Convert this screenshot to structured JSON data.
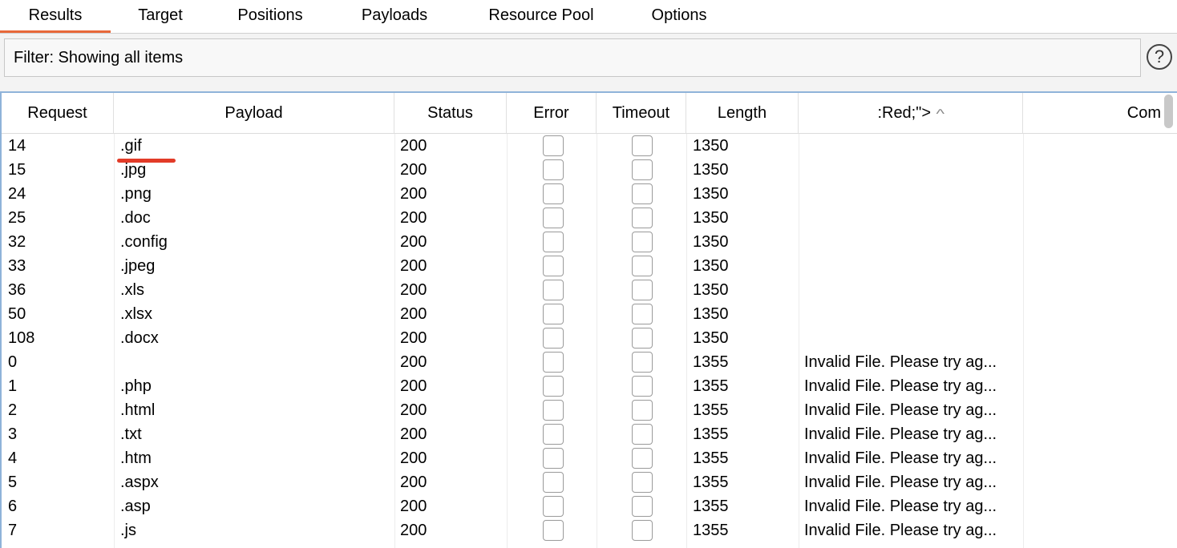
{
  "tabs": [
    {
      "label": "Results"
    },
    {
      "label": "Target"
    },
    {
      "label": "Positions"
    },
    {
      "label": "Payloads"
    },
    {
      "label": "Resource Pool"
    },
    {
      "label": "Options"
    }
  ],
  "filter": {
    "text": "Filter: Showing all items",
    "help_icon": "?"
  },
  "table": {
    "headers": [
      "Request",
      "Payload",
      "Status",
      "Error",
      "Timeout",
      "Length",
      ":Red;\">",
      "Com"
    ],
    "rows": [
      {
        "request": "14",
        "payload": ".gif",
        "status": "200",
        "length": "1350",
        "extract": ""
      },
      {
        "request": "15",
        "payload": ".jpg",
        "status": "200",
        "length": "1350",
        "extract": ""
      },
      {
        "request": "24",
        "payload": ".png",
        "status": "200",
        "length": "1350",
        "extract": ""
      },
      {
        "request": "25",
        "payload": ".doc",
        "status": "200",
        "length": "1350",
        "extract": ""
      },
      {
        "request": "32",
        "payload": ".config",
        "status": "200",
        "length": "1350",
        "extract": ""
      },
      {
        "request": "33",
        "payload": ".jpeg",
        "status": "200",
        "length": "1350",
        "extract": ""
      },
      {
        "request": "36",
        "payload": ".xls",
        "status": "200",
        "length": "1350",
        "extract": ""
      },
      {
        "request": "50",
        "payload": ".xlsx",
        "status": "200",
        "length": "1350",
        "extract": ""
      },
      {
        "request": "108",
        "payload": ".docx",
        "status": "200",
        "length": "1350",
        "extract": ""
      },
      {
        "request": "0",
        "payload": "",
        "status": "200",
        "length": "1355",
        "extract": "Invalid File. Please try ag..."
      },
      {
        "request": "1",
        "payload": ".php",
        "status": "200",
        "length": "1355",
        "extract": "Invalid File. Please try ag..."
      },
      {
        "request": "2",
        "payload": ".html",
        "status": "200",
        "length": "1355",
        "extract": "Invalid File. Please try ag..."
      },
      {
        "request": "3",
        "payload": ".txt",
        "status": "200",
        "length": "1355",
        "extract": "Invalid File. Please try ag..."
      },
      {
        "request": "4",
        "payload": ".htm",
        "status": "200",
        "length": "1355",
        "extract": "Invalid File. Please try ag..."
      },
      {
        "request": "5",
        "payload": ".aspx",
        "status": "200",
        "length": "1355",
        "extract": "Invalid File. Please try ag..."
      },
      {
        "request": "6",
        "payload": ".asp",
        "status": "200",
        "length": "1355",
        "extract": "Invalid File. Please try ag..."
      },
      {
        "request": "7",
        "payload": ".js",
        "status": "200",
        "length": "1355",
        "extract": "Invalid File. Please try ag..."
      }
    ]
  },
  "colors": {
    "active_tab": "#e8683a",
    "annotation": "#e23b28",
    "table_border": "#8fb3d9"
  }
}
